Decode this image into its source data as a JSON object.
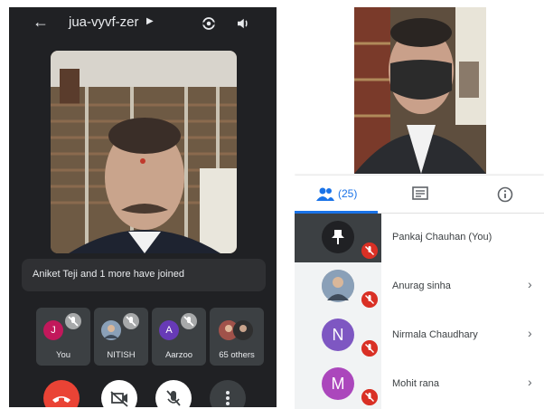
{
  "left_call": {
    "meeting_code": "jua-vyvf-zer",
    "join_message": "Aniket Teji and 1 more have joined",
    "tiles": [
      {
        "avatar_letter": "J",
        "avatar_color": "#c2185b",
        "label": "You"
      },
      {
        "avatar_letter": "",
        "avatar_color": "#5f6368",
        "label": "NITISH"
      },
      {
        "avatar_letter": "A",
        "avatar_color": "#673ab7",
        "label": "Aarzoo"
      },
      {
        "avatar_letter": "",
        "avatar_color": "#8d4e3e",
        "label": "65 others"
      }
    ],
    "colors": {
      "end_call": "#ea4335",
      "control_bg": "#ffffff",
      "more_bg": "#3c4043"
    }
  },
  "right_panel": {
    "tabs": {
      "people_count": "(25)",
      "active": "people"
    },
    "participants": [
      {
        "name": "Pankaj Chauhan (You)",
        "avatar_letter": "",
        "avatar_color": "#202124",
        "pinned": true,
        "muted": true,
        "has_chevron": false
      },
      {
        "name": "Anurag sinha",
        "avatar_letter": "",
        "avatar_color": "#9e9e9e",
        "pinned": false,
        "muted": true,
        "has_chevron": true
      },
      {
        "name": "Nirmala Chaudhary",
        "avatar_letter": "N",
        "avatar_color": "#7e57c2",
        "pinned": false,
        "muted": true,
        "has_chevron": true
      },
      {
        "name": "Mohit rana",
        "avatar_letter": "M",
        "avatar_color": "#ab47bc",
        "pinned": false,
        "muted": true,
        "has_chevron": true
      }
    ],
    "colors": {
      "accent": "#1a73e8",
      "mute_badge": "#d93025"
    }
  },
  "icons": {
    "back": "arrow-left-icon",
    "switch_camera": "switch-camera-icon",
    "speaker": "speaker-icon",
    "people": "people-icon",
    "chat": "chat-icon",
    "info": "info-icon",
    "pin": "pin-icon",
    "mic_off": "mic-off-icon",
    "end_call": "end-call-icon",
    "camera_off": "camera-off-icon",
    "more": "more-vert-icon"
  }
}
